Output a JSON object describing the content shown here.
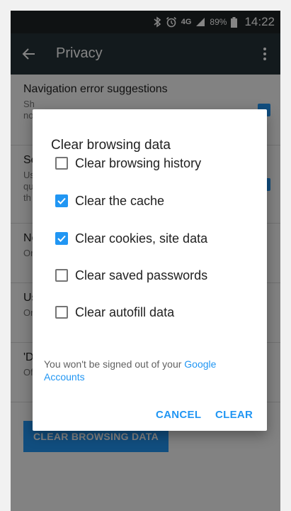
{
  "status_bar": {
    "network": "4G",
    "battery": "89%",
    "time": "14:22",
    "icons": [
      "bluetooth-icon",
      "alarm-icon",
      "signal-icon",
      "battery-icon"
    ]
  },
  "toolbar": {
    "title": "Privacy",
    "icons": [
      "back-arrow-icon",
      "more-vert-icon"
    ]
  },
  "background_items": [
    {
      "title": "Navigation error suggestions",
      "subtitle": "Sh\nno",
      "checked": true
    },
    {
      "title": "Se",
      "subtitle": "Us\nqu\nth",
      "checked": true
    },
    {
      "title": "Ne",
      "subtitle": "Or",
      "checked": false
    },
    {
      "title": "Us",
      "subtitle": "Or",
      "checked": false
    },
    {
      "title": "'D",
      "subtitle": "Of",
      "checked": false
    }
  ],
  "background_button": "CLEAR BROWSING DATA",
  "dialog": {
    "title": "Clear browsing data",
    "options": [
      {
        "label": "Clear browsing history",
        "checked": false
      },
      {
        "label": "Clear the cache",
        "checked": true
      },
      {
        "label": "Clear cookies, site data",
        "checked": true
      },
      {
        "label": "Clear saved passwords",
        "checked": false
      },
      {
        "label": "Clear autofill data",
        "checked": false
      }
    ],
    "note_text": "You won't be signed out of your ",
    "note_link": "Google Accounts",
    "cancel_label": "CANCEL",
    "clear_label": "CLEAR"
  },
  "colors": {
    "accent": "#2196f3",
    "toolbar": "#263238",
    "status_bar": "#1e2326"
  }
}
